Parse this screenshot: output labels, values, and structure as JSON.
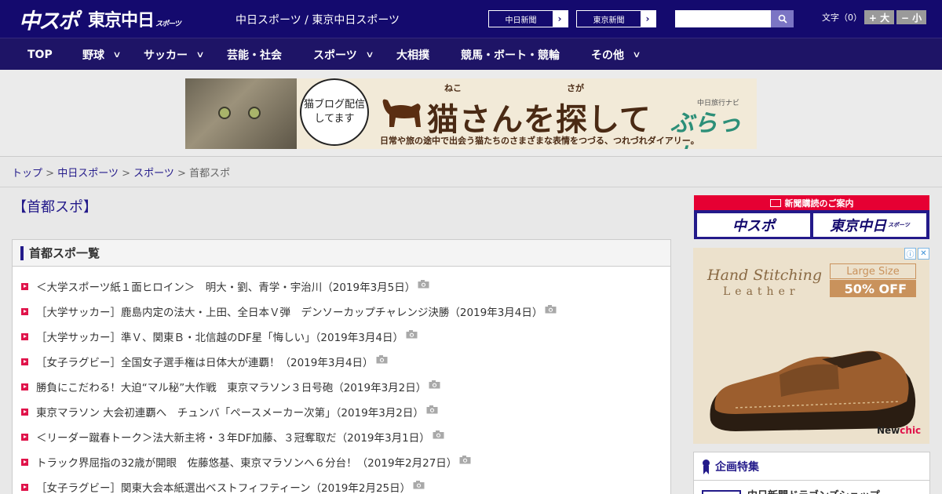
{
  "header": {
    "logo_chuspo": "中スポ",
    "logo_tokyo": "東京中日",
    "logo_tokyo_sub": "スポーツ",
    "site_names": "中日スポーツ / 東京中日スポーツ",
    "paper_links": [
      {
        "label": "中日新聞",
        "arrow": "›"
      },
      {
        "label": "東京新聞",
        "arrow": "›"
      }
    ],
    "search": {
      "placeholder": "",
      "value": ""
    },
    "font_size_label": "文字（0）",
    "font_larger": "+ 大",
    "font_smaller": "− 小"
  },
  "nav": {
    "items": [
      {
        "label": "TOP",
        "has_menu": false
      },
      {
        "label": "野球",
        "has_menu": true
      },
      {
        "label": "サッカー",
        "has_menu": true
      },
      {
        "label": "芸能・社会",
        "has_menu": false
      },
      {
        "label": "スポーツ",
        "has_menu": true
      },
      {
        "label": "大相撲",
        "has_menu": false
      },
      {
        "label": "競馬・ボート・競輪",
        "has_menu": false
      },
      {
        "label": "その他",
        "has_menu": true
      }
    ],
    "chevron": "∨"
  },
  "banner": {
    "bubble_text": "猫ブログ配信してます",
    "title": "猫さんを探して",
    "ruby_neko": "ねこ",
    "ruby_saga": "さが",
    "subtitle": "日常や旅の途中で出会う猫たちのさまざまな表情をつづる、つれづれダイアリー。",
    "brand_small": "中日旅行ナビ",
    "brand": "ぶらっ人"
  },
  "breadcrumb": {
    "items": [
      "トップ",
      "中日スポーツ",
      "スポーツ"
    ],
    "current": "首都スポ",
    "separator": ">"
  },
  "page_title": "【首都スポ】",
  "article_list": {
    "heading": "首都スポ一覧",
    "items": [
      {
        "title": "＜大学スポーツ紙１面ヒロイン＞　明大・劉、青学・宇治川（2019年3月5日）",
        "has_photo": true
      },
      {
        "title": "［大学サッカー］鹿島内定の法大・上田、全日本Ｖ弾　デンソーカップチャレンジ決勝（2019年3月4日）",
        "has_photo": true
      },
      {
        "title": "［大学サッカー］準Ｖ、関東Ｂ・北信越のDF星「悔しい」（2019年3月4日）",
        "has_photo": true
      },
      {
        "title": "［女子ラグビー］全国女子選手権は日体大が連覇！（2019年3月4日）",
        "has_photo": true
      },
      {
        "title": "勝負にこだわる！大迫“マル秘”大作戦　東京マラソン３日号砲（2019年3月2日）",
        "has_photo": true
      },
      {
        "title": "東京マラソン 大会初連覇へ　チュンバ「ペースメーカー次第」（2019年3月2日）",
        "has_photo": true
      },
      {
        "title": "＜リーダー蹴春トーク＞法大新主将・３年DF加藤、３冠奪取だ（2019年3月1日）",
        "has_photo": true
      },
      {
        "title": "トラック界屈指の32歳が開眼　佐藤悠基、東京マラソンへ６分台！（2019年2月27日）",
        "has_photo": true
      },
      {
        "title": "［女子ラグビー］関東大会本紙選出ベストフィフティーン（2019年2月25日）",
        "has_photo": true
      }
    ]
  },
  "sidebar": {
    "subscription": {
      "heading": "新聞購読のご案内",
      "btn_chuspo": "中スポ",
      "btn_tokyo": "東京中日",
      "btn_tokyo_sub": "スポーツ"
    },
    "ad": {
      "script_line1": "Hand Stitching",
      "script_line2": "Leather",
      "size_label": "Large Size",
      "discount": "50% OFF",
      "brand_prefix": "New",
      "brand_suffix": "chic",
      "info_icon": "ⓘ",
      "close_icon": "✕"
    },
    "feature": {
      "heading": "企画特集",
      "item_label": "中日新聞ドラゴンズショップ"
    }
  },
  "colors": {
    "brand_navy": "#140a6e",
    "nav_bg": "#1e1466",
    "accent_red": "#e0134a",
    "link": "#231a8a"
  }
}
